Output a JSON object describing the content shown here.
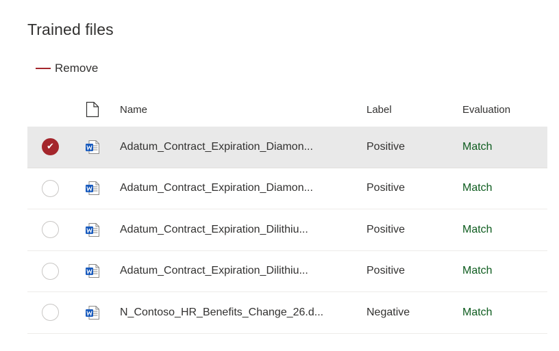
{
  "title": "Trained files",
  "command_bar": {
    "remove_label": "Remove",
    "remove_icon": "minus-icon"
  },
  "table": {
    "columns": {
      "file_type_icon": "file-icon",
      "name": "Name",
      "label": "Label",
      "evaluation": "Evaluation"
    },
    "rows": [
      {
        "selected": true,
        "icon": "word-document-icon",
        "name": "Adatum_Contract_Expiration_Diamon...",
        "label": "Positive",
        "evaluation": "Match"
      },
      {
        "selected": false,
        "icon": "word-document-icon",
        "name": "Adatum_Contract_Expiration_Diamon...",
        "label": "Positive",
        "evaluation": "Match"
      },
      {
        "selected": false,
        "icon": "word-document-icon",
        "name": "Adatum_Contract_Expiration_Dilithiu...",
        "label": "Positive",
        "evaluation": "Match"
      },
      {
        "selected": false,
        "icon": "word-document-icon",
        "name": "Adatum_Contract_Expiration_Dilithiu...",
        "label": "Positive",
        "evaluation": "Match"
      },
      {
        "selected": false,
        "icon": "word-document-icon",
        "name": "N_Contoso_HR_Benefits_Change_26.d...",
        "label": "Negative",
        "evaluation": "Match"
      }
    ]
  },
  "colors": {
    "accent": "#a4262c",
    "match_text": "#0e5c1f",
    "selected_row_bg": "#e9e9e9",
    "word_blue": "#185abd"
  }
}
